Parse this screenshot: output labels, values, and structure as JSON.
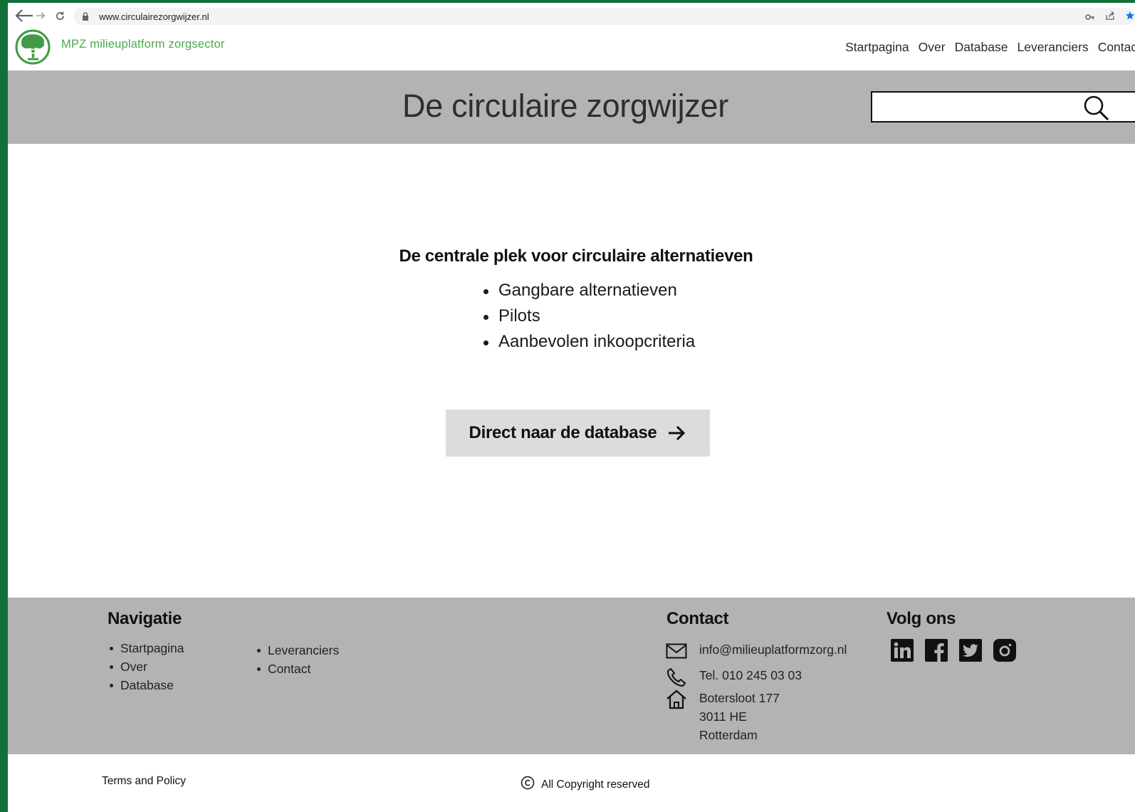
{
  "browser": {
    "url": "www.circulairezorgwijzer.nl",
    "icons": [
      "back-icon",
      "forward-icon",
      "reload-icon",
      "lock-icon",
      "key-icon",
      "share-icon",
      "bookmark-star-icon"
    ]
  },
  "header": {
    "brand": "MPZ milieuplatform zorgsector",
    "nav": [
      "Startpagina",
      "Over",
      "Database",
      "Leveranciers",
      "Contact"
    ]
  },
  "hero": {
    "title": "De circulaire zorgwijzer",
    "search_value": "",
    "search_placeholder": ""
  },
  "main": {
    "heading": "De centrale plek voor circulaire alternatieven",
    "features": [
      "Gangbare alternatieven",
      "Pilots",
      "Aanbevolen inkoopcriteria"
    ],
    "cta_label": "Direct naar de database"
  },
  "footer": {
    "nav_heading": "Navigatie",
    "nav_col1": [
      "Startpagina",
      "Over",
      "Database"
    ],
    "nav_col2": [
      "Leveranciers",
      "Contact"
    ],
    "contact_heading": "Contact",
    "email": "info@milieuplatformzorg.nl",
    "phone": "Tel. 010 245 03 03",
    "address": [
      "Botersloot 177",
      "3011 HE",
      "Rotterdam"
    ],
    "follow_heading": "Volg ons",
    "social": [
      "linkedin-icon",
      "facebook-icon",
      "twitter-icon",
      "instagram-icon"
    ]
  },
  "bottom": {
    "terms": "Terms and Policy",
    "copyright": "All Copyright reserved"
  },
  "colors": {
    "frame": "#11703a",
    "brand_green": "#4aa84e",
    "band_gray": "#b3b3b3",
    "button_gray": "#dcdcdc"
  }
}
